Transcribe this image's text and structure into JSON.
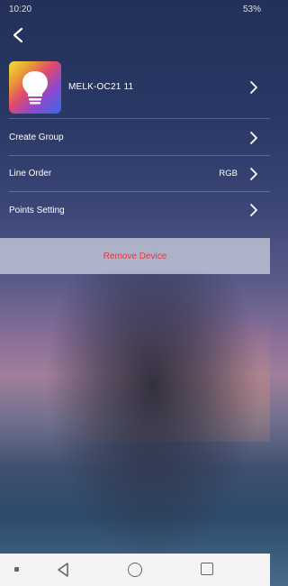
{
  "statusbar": {
    "time": "10:20",
    "right": "53%"
  },
  "device": {
    "name": "MELK-OC21   11",
    "icon": "lightbulb-icon"
  },
  "menu": {
    "create_group": "Create Group",
    "line_order": "Line Order",
    "line_order_value": "RGB",
    "points_setting": "Points Setting"
  },
  "remove": {
    "label": "Remove Device",
    "color": "#e8363a"
  }
}
